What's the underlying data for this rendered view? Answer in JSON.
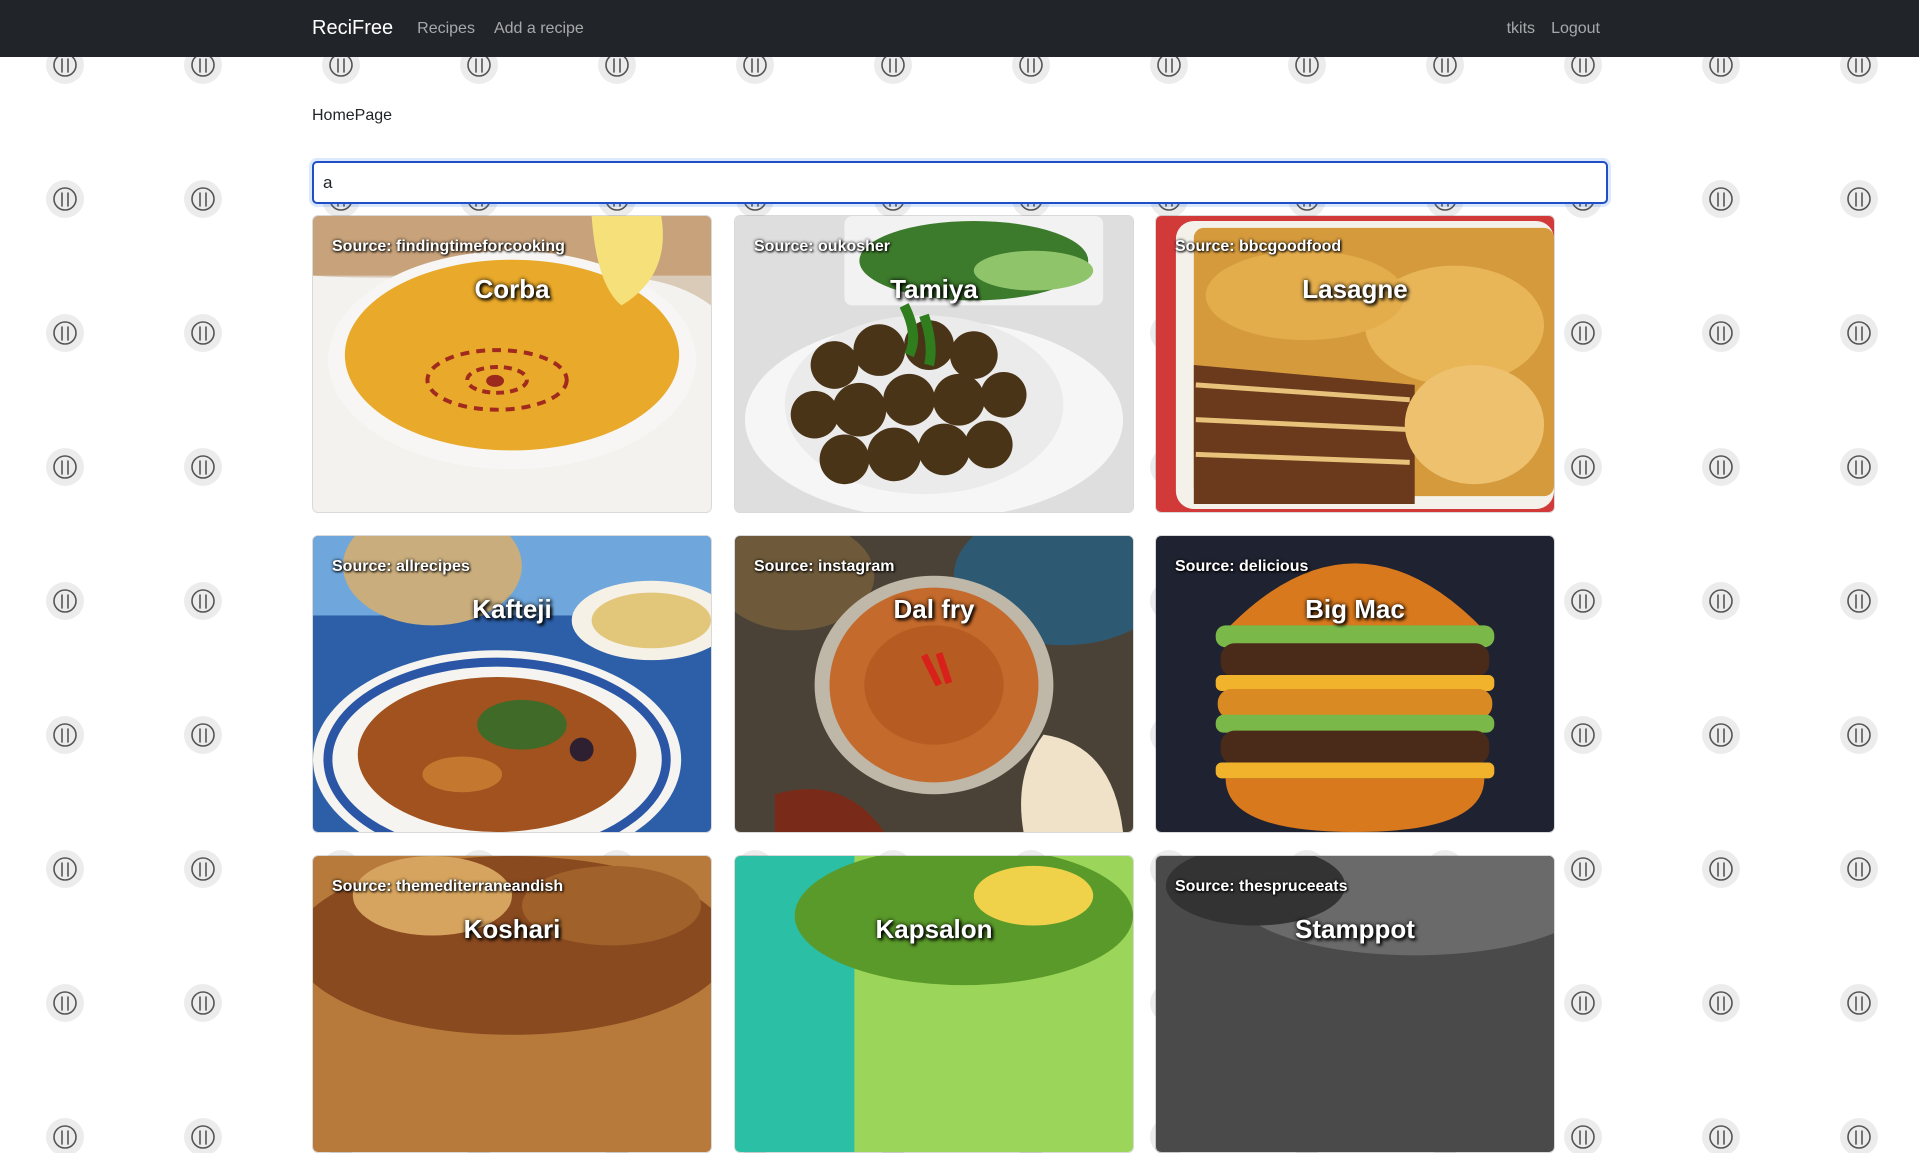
{
  "nav": {
    "brand": "ReciFree",
    "links": [
      "Recipes",
      "Add a recipe"
    ],
    "user": "tkits",
    "logout": "Logout"
  },
  "page": {
    "title": "HomePage"
  },
  "search": {
    "value": "a"
  },
  "recipes": [
    {
      "source": "Source: findingtimeforcooking",
      "title": "Corba"
    },
    {
      "source": "Source: oukosher",
      "title": "Tamiya"
    },
    {
      "source": "Source: bbcgoodfood",
      "title": "Lasagne"
    },
    {
      "source": "Source: allrecipes",
      "title": "Kafteji"
    },
    {
      "source": "Source: instagram",
      "title": "Dal fry"
    },
    {
      "source": "Source: delicious",
      "title": "Big Mac"
    },
    {
      "source": "Source: themediterraneandish",
      "title": "Koshari"
    },
    {
      "source": "",
      "title": "Kapsalon"
    },
    {
      "source": "Source: thespruceeats",
      "title": "Stamppot"
    }
  ],
  "icons": {
    "background_pattern": "fork-knife-icon"
  },
  "colors": {
    "navbar": "#212529",
    "search_focus": "#1f4fc4"
  }
}
